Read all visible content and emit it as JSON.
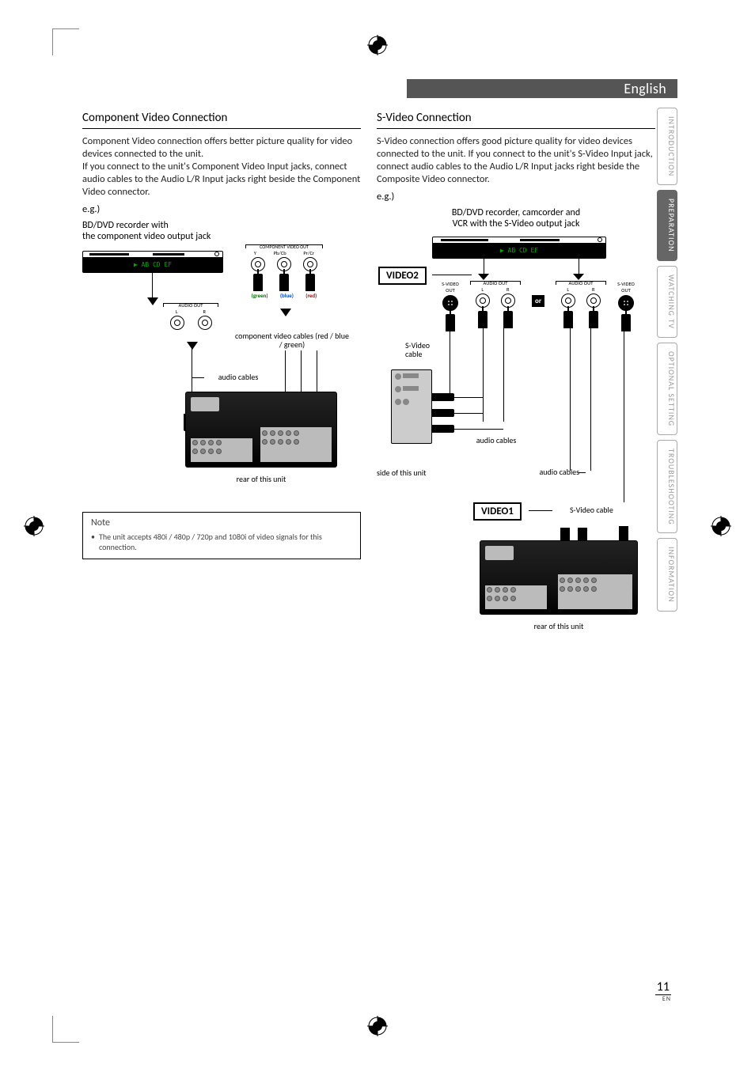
{
  "language": "English",
  "tabs": [
    "INTRODUCTION",
    "PREPARATION",
    "WATCHING TV",
    "OPTIONAL SETTING",
    "TROUBLESHOOTING",
    "INFORMATION"
  ],
  "active_tab_index": 1,
  "page_number": "11",
  "page_lang_code": "EN",
  "left": {
    "heading": "Component Video Connection",
    "para": "Component Video connection offers better picture quality for video devices connected to the unit.\nIf you connect to the unit's Component Video Input jacks, connect audio cables to the Audio L/R Input jacks right beside the Component Video connector.",
    "eg": "e.g.)",
    "device_label": "BD/DVD recorder with\nthe component video output jack",
    "comp_out_header": "COMPONENT VIDEO OUT",
    "comp_out_labels": [
      "Y",
      "Pb/Cb",
      "Pr/Cr"
    ],
    "comp_colors": [
      "(green)",
      "(blue)",
      "(red)"
    ],
    "audio_out_header": "AUDIO OUT",
    "audio_out_labels": [
      "L",
      "R"
    ],
    "display_text": "▶  AB CD EF",
    "comp_cable_label": "component video cables\n(red / blue / green)",
    "audio_cable_label": "audio cables",
    "rear_caption": "rear of this unit",
    "note_title": "Note",
    "note_text": "The unit accepts 480i / 480p / 720p and 1080i of video signals for this connection."
  },
  "right": {
    "heading": "S-Video Connection",
    "para": "S-Video connection offers good picture quality for video devices connected to the unit. If you connect to the unit's S-Video Input jack, connect audio cables to the Audio L/R Input jacks right beside the Composite Video connector.",
    "eg": "e.g.)",
    "device_label": "BD/DVD recorder, camcorder and\nVCR with the S-Video output jack",
    "video2": "VIDEO2",
    "video1": "VIDEO1",
    "svideo_out": "S-VIDEO\nOUT",
    "audio_out_header": "AUDIO OUT",
    "audio_out_labels": [
      "L",
      "R"
    ],
    "or": "or",
    "svideo_cable": "S-Video\ncable",
    "audio_cables": "audio cables",
    "side_caption": "side of this unit",
    "svideo_cable2": "S-Video cable",
    "rear_caption": "rear of this unit",
    "display_text": "▶  AB CD EF"
  }
}
